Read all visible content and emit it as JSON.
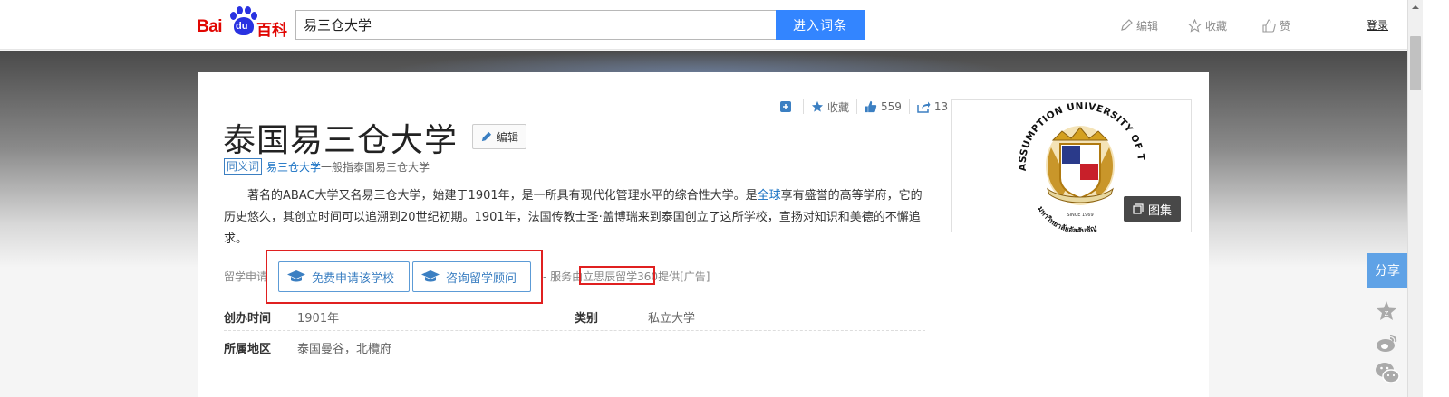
{
  "logo": {
    "bai": "Bai",
    "du": "du",
    "baike": "百科"
  },
  "search": {
    "value": "易三仓大学",
    "button_label": "进入词条"
  },
  "top_actions": {
    "edit": "编辑",
    "collect": "收藏",
    "like": "赞",
    "login": "登录"
  },
  "tools": {
    "collect": "收藏",
    "likes": "559",
    "shares": "13"
  },
  "entry": {
    "title": "泰国易三仓大学",
    "edit_label": "编辑",
    "synonym_tag": "同义词",
    "synonym_link": "易三仓大学",
    "synonym_desc": "一般指泰国易三仓大学",
    "summary_1": "著名的ABAC大学又名易三仓大学，始建于1901年，是一所具有现代化管理水平的综合性大学。是",
    "summary_link": "全球",
    "summary_2": "享有盛誉的高等学府，它的历史悠久，其创立时间可以追溯到20世纪初期。1901年，法国传教士圣·盖博瑞来到泰国创立了这所学校，宣扬对知识和美德的不懈追求。"
  },
  "ad": {
    "label": "留学申请",
    "apply_button": "免费申请该学校",
    "consult_button": "咨询留学顾问",
    "provider_prefix": "- 服务由",
    "provider_name": "立思辰留学360",
    "provider_suffix": "提供[广告]"
  },
  "basic_info": [
    {
      "key": "创办时间",
      "value": "1901年"
    },
    {
      "key": "类别",
      "value": "私立大学"
    },
    {
      "key": "所属地区",
      "value": "泰国曼谷，北欖府"
    }
  ],
  "picture": {
    "seal_top_text": "ASSUMPTION UNIVERSITY OF THAILAND",
    "seal_bottom_text": "มหาวิทยาลัยอัสสัมชัญ",
    "seal_year": "SINCE 1969",
    "album_label": "图集"
  },
  "share": {
    "label": "分享"
  },
  "colors": {
    "accent": "#3385ff",
    "link": "#136ec2",
    "logo_red": "#e10602",
    "logo_blue": "#2932e1",
    "highlight_box": "#e02020"
  }
}
